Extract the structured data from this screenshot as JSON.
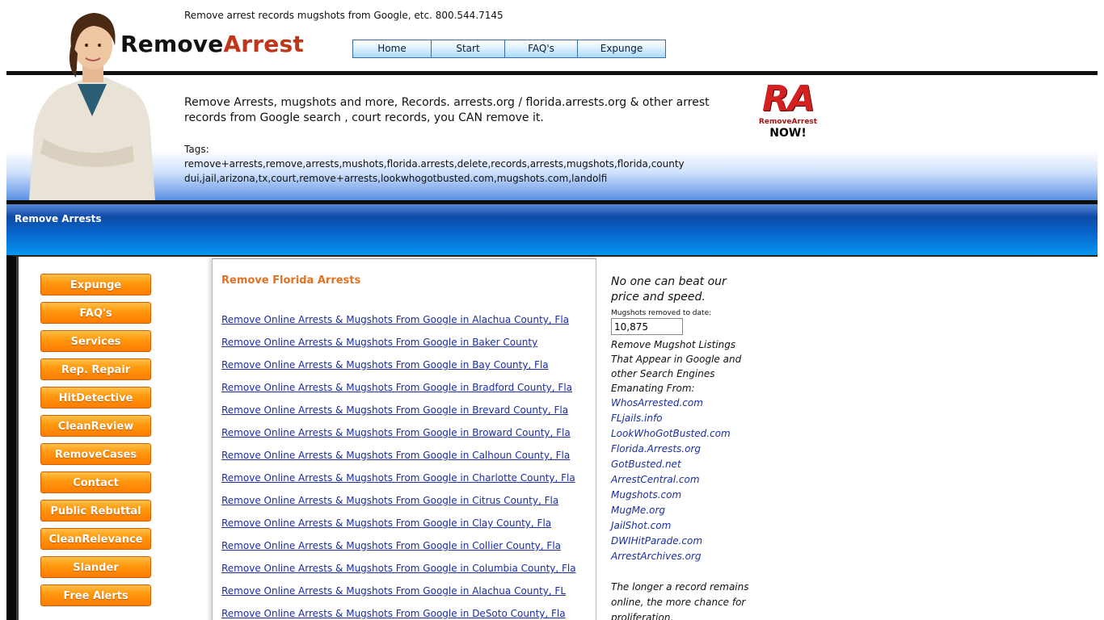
{
  "header": {
    "tagline": "Remove arrest records mugshots from Google, etc.  800.544.7145",
    "logo_part1": "Remove",
    "logo_part2": "Arrest",
    "nav": [
      "Home",
      "Start",
      "FAQ's",
      "Expunge"
    ]
  },
  "banner": {
    "headline": "Remove Arrests, mugshots and more, Records. arrests.org / florida.arrests.org & other arrest records from Google search , court records, you CAN remove it.",
    "tags": "Tags: remove+arrests,remove,arrests,mushots,florida.arrests,delete,records,arrests,mugshots,florida,county dui,jail,arizona,tx,court,remove+arrests,lookwhogotbusted.com,mugshots.com,landolfi",
    "ra_logo": {
      "mark": "RA",
      "sub": "RemoveArrest",
      "now": "NOW!"
    }
  },
  "section_bar": {
    "label": "Remove Arrests"
  },
  "sidenav": [
    "Expunge",
    "FAQ's",
    "Services",
    "Rep. Repair",
    "HitDetective",
    "CleanReview",
    "RemoveCases",
    "Contact",
    "Public Rebuttal",
    "CleanRelevance",
    "Slander",
    "Free Alerts"
  ],
  "main": {
    "title": "Remove Florida Arrests",
    "links": [
      "Remove Online Arrests & Mugshots From Google in Alachua County, Fla",
      "Remove Online Arrests & Mugshots From Google in Baker County",
      "Remove Online Arrests & Mugshots From Google in Bay County, Fla",
      "Remove Online Arrests & Mugshots From Google in Bradford County, Fla",
      "Remove Online Arrests & Mugshots From Google in Brevard County, Fla",
      "Remove Online Arrests & Mugshots From Google in Broward County, Fla",
      "Remove Online Arrests & Mugshots From Google in Calhoun County, Fla",
      "Remove Online Arrests & Mugshots From Google in Charlotte County, Fla",
      "Remove Online Arrests & Mugshots From Google in Citrus County, Fla",
      "Remove Online Arrests & Mugshots From Google in Clay County, Fla",
      "Remove Online Arrests & Mugshots From Google in Collier County, Fla",
      "Remove Online Arrests & Mugshots From Google in Columbia County, Fla",
      "Remove Online Arrests & Mugshots From Google in Alachua County, FL",
      "Remove Online Arrests & Mugshots From Google in DeSoto County, Fla"
    ]
  },
  "right": {
    "promo": "No one can beat our price and speed.",
    "counter_label": "Mugshots removed to date:",
    "counter_value": "10,875",
    "desc": "Remove Mugshot Listings That Appear in Google and other Search Engines Emanating From:",
    "sites": [
      "WhosArrested.com",
      "FLjails.info",
      "LookWhoGotBusted.com",
      "Florida.Arrests.org",
      "GotBusted.net",
      "ArrestCentral.com",
      "Mugshots.com",
      "MugMe.org",
      "JailShot.com",
      "DWIHitParade.com",
      "ArrestArchives.org"
    ],
    "closing": "The longer a record remains online, the more chance for proliferation."
  },
  "colors": {
    "nav_orange": "#ff8c00",
    "link_blue": "#1a2ea0",
    "heading_orange": "#e07226",
    "logo_red": "#c0361b",
    "bar_blue": "#0863c9"
  }
}
